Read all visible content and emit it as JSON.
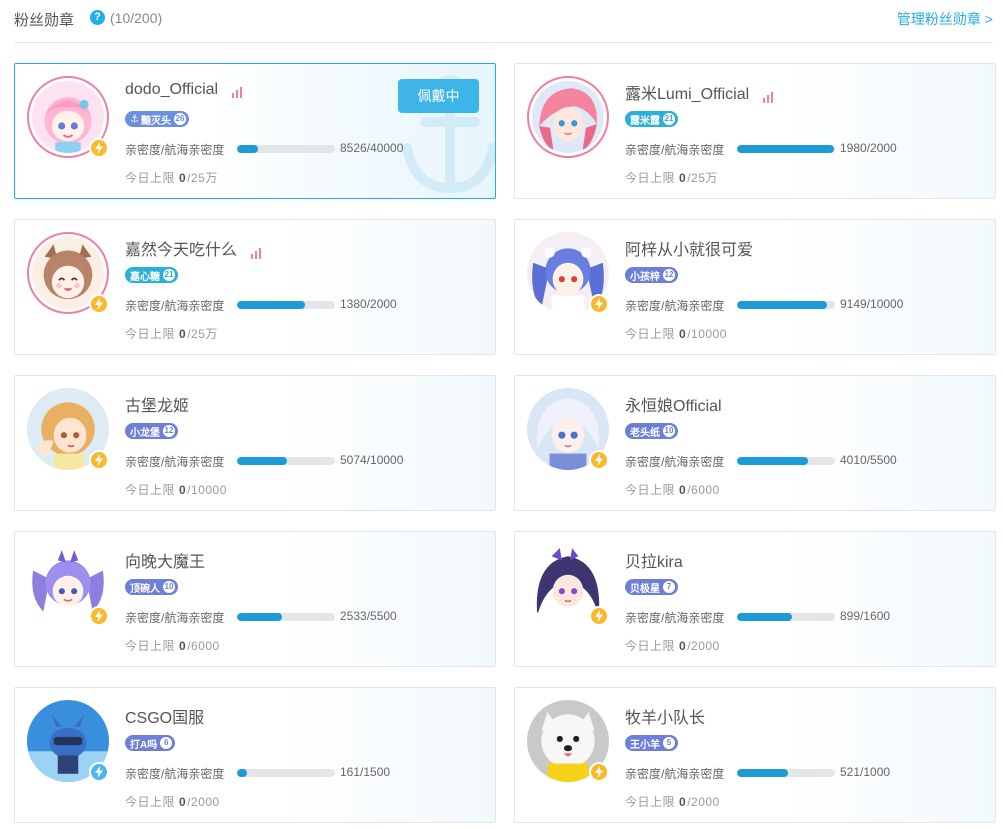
{
  "header": {
    "title": "粉丝勋章",
    "help_icon": "question-circle-icon",
    "count": "(10/200)",
    "manage_link": "管理粉丝勋章 >"
  },
  "labels": {
    "intimacy": "亲密度/航海亲密度",
    "today_limit": "今日上限",
    "wearing": "佩戴中"
  },
  "colors": {
    "accent": "#23ade5",
    "progress": "#1d9bd8",
    "live_pink": "#f07ea0",
    "badge_yellow": "#fbb82a"
  },
  "cards": [
    {
      "name": "dodo_Official",
      "live": true,
      "medal": "黯灭头",
      "level": "26",
      "medal_color": "#6d8fe0",
      "anchor": true,
      "progress": "8526/40000",
      "fraction": 0.213,
      "limit_used": "0",
      "limit_total": "/25万",
      "wearing": true,
      "ringed": true,
      "avatar": "pink-hair-girl",
      "badge": "yellow"
    },
    {
      "name": "露米Lumi_Official",
      "live": true,
      "medal": "露米露",
      "level": "21",
      "medal_color": "#2bb0d8",
      "anchor": false,
      "progress": "1980/2000",
      "fraction": 0.99,
      "limit_used": "0",
      "limit_total": "/25万",
      "wearing": false,
      "ringed": true,
      "avatar": "mermaid-girl",
      "badge": "none"
    },
    {
      "name": "嘉然今天吃什么",
      "live": true,
      "medal": "嘉心糖",
      "level": "21",
      "medal_color": "#2bb0d8",
      "anchor": false,
      "progress": "1380/2000",
      "fraction": 0.69,
      "limit_used": "0",
      "limit_total": "/25万",
      "wearing": false,
      "ringed": true,
      "avatar": "brown-hair-girl",
      "badge": "yellow"
    },
    {
      "name": "阿梓从小就很可爱",
      "live": false,
      "medal": "小孩梓",
      "level": "12",
      "medal_color": "#6d7fd8",
      "anchor": false,
      "progress": "9149/10000",
      "fraction": 0.915,
      "limit_used": "0",
      "limit_total": "/10000",
      "wearing": false,
      "ringed": false,
      "avatar": "twin-tail-girl",
      "badge": "yellow"
    },
    {
      "name": "古堡龙姬",
      "live": false,
      "medal": "小龙堡",
      "level": "12",
      "medal_color": "#6d7fd8",
      "anchor": false,
      "progress": "5074/10000",
      "fraction": 0.507,
      "limit_used": "0",
      "limit_total": "/10000",
      "wearing": false,
      "ringed": false,
      "avatar": "blonde-girl",
      "badge": "yellow"
    },
    {
      "name": "永恒娘Official",
      "live": false,
      "medal": "老头纸",
      "level": "10",
      "medal_color": "#6d7fd8",
      "anchor": false,
      "progress": "4010/5500",
      "fraction": 0.729,
      "limit_used": "0",
      "limit_total": "/6000",
      "wearing": false,
      "ringed": false,
      "avatar": "white-hair-girl",
      "badge": "yellow"
    },
    {
      "name": "向晚大魔王",
      "live": false,
      "medal": "顶碗人",
      "level": "10",
      "medal_color": "#6d7fd8",
      "anchor": false,
      "progress": "2533/5500",
      "fraction": 0.46,
      "limit_used": "0",
      "limit_total": "/6000",
      "wearing": false,
      "ringed": false,
      "avatar": "purple-twin-girl",
      "badge": "yellow"
    },
    {
      "name": "贝拉kira",
      "live": false,
      "medal": "贝极星",
      "level": "7",
      "medal_color": "#6d7fd8",
      "anchor": false,
      "progress": "899/1600",
      "fraction": 0.562,
      "limit_used": "0",
      "limit_total": "/2000",
      "wearing": false,
      "ringed": false,
      "avatar": "dark-hair-girl",
      "badge": "yellow"
    },
    {
      "name": "CSGO国服",
      "live": false,
      "medal": "打A吗",
      "level": "6",
      "medal_color": "#6d7fd8",
      "anchor": false,
      "progress": "161/1500",
      "fraction": 0.107,
      "limit_used": "0",
      "limit_total": "/2000",
      "wearing": false,
      "ringed": false,
      "avatar": "blue-mascot",
      "badge": "blue"
    },
    {
      "name": "牧羊小队长",
      "live": false,
      "medal": "王小羊",
      "level": "5",
      "medal_color": "#6d7fd8",
      "anchor": false,
      "progress": "521/1000",
      "fraction": 0.521,
      "limit_used": "0",
      "limit_total": "/2000",
      "wearing": false,
      "ringed": false,
      "avatar": "white-dog",
      "badge": "yellow"
    }
  ]
}
